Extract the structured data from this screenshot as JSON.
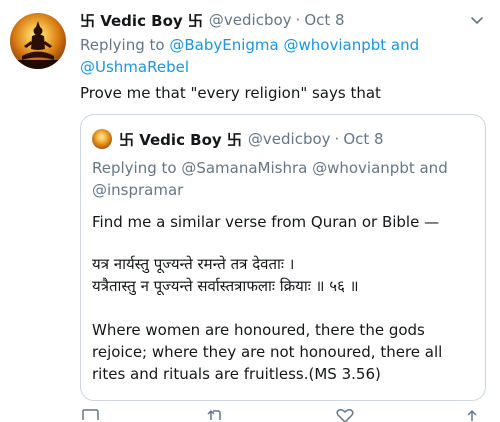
{
  "tweet": {
    "display_name": "卐 Vedic Boy 卐",
    "handle": "@vedicboy",
    "separator": "·",
    "date": "Oct 8",
    "replying_to_label": "Replying to",
    "mention_1": "@BabyEnigma",
    "mention_2": "@whovianpbt",
    "and_word": "and",
    "mention_3": "@UshmaRebel",
    "text": "Prove me that \"every religion\" says that"
  },
  "quoted_tweet": {
    "display_name": "卐 Vedic Boy 卐",
    "handle": "@vedicboy",
    "separator": "·",
    "date": "Oct 8",
    "replying_to": "Replying to @SamanaMishra @whovianpbt and @inspramar",
    "body": "Find me a similar verse from Quran or Bible —",
    "verse_line_1": "यत्र नार्यस्तु पूज्यन्ते रमन्ते तत्र देवताः ।",
    "verse_line_2": "यत्रैतास्तु न पूज्यन्ते सर्वास्तत्राफलाः क्रियाः ॥ ५६ ॥",
    "translation": "Where women are honoured, there the gods rejoice; where they are not honoured, there all rites and rituals are fruitless.(MS 3.56)"
  },
  "icons": [
    "avatar",
    "chevron-down-icon",
    "reply-icon",
    "retweet-icon",
    "like-icon",
    "share-icon"
  ],
  "colors": {
    "link": "#1b95e0",
    "secondary_text": "#657786",
    "border": "#ccd6dd",
    "text": "#14171a"
  }
}
